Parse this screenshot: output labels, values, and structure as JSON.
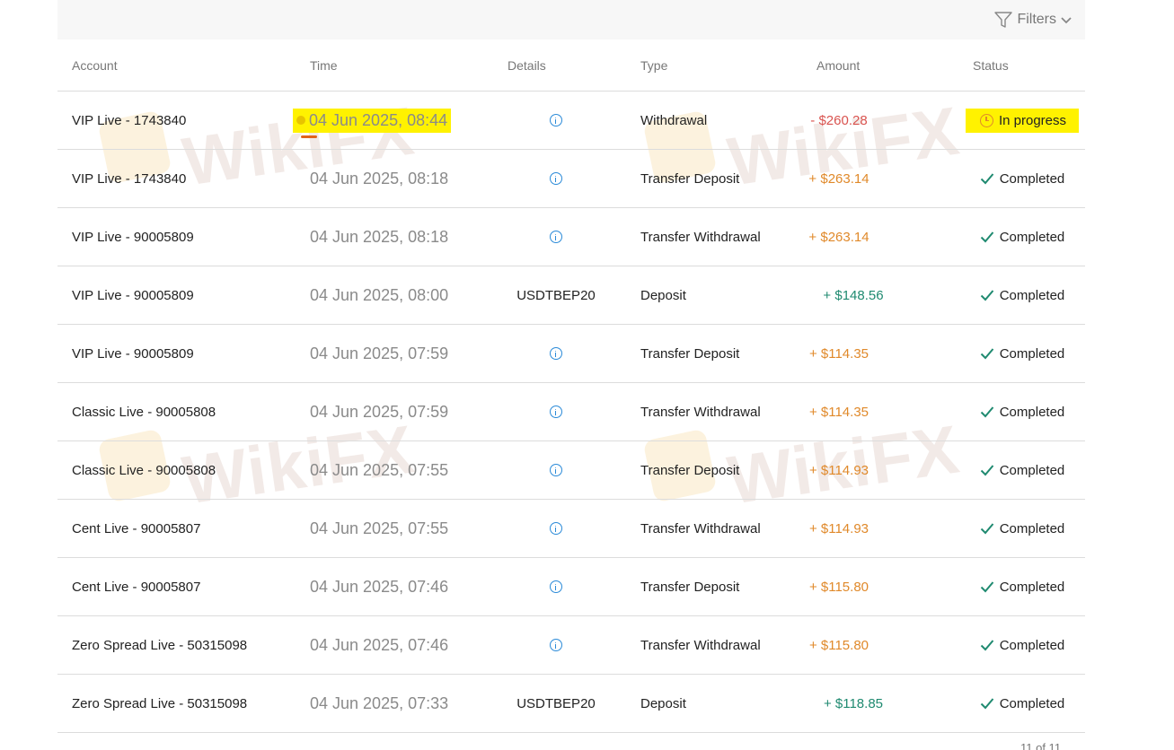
{
  "filters": {
    "label": "Filters"
  },
  "columns": {
    "account": "Account",
    "time": "Time",
    "details": "Details",
    "type": "Type",
    "amount": "Amount",
    "status": "Status"
  },
  "rows": [
    {
      "account": "VIP Live - 1743840",
      "time": "04 Jun 2025, 08:44",
      "details": "",
      "type": "Withdrawal",
      "amount": "- $260.28",
      "status": "In progress"
    },
    {
      "account": "VIP Live - 1743840",
      "time": "04 Jun 2025, 08:18",
      "details": "",
      "type": "Transfer Deposit",
      "amount": "+ $263.14",
      "status": "Completed"
    },
    {
      "account": "VIP Live - 90005809",
      "time": "04 Jun 2025, 08:18",
      "details": "",
      "type": "Transfer Withdrawal",
      "amount": "+ $263.14",
      "status": "Completed"
    },
    {
      "account": "VIP Live - 90005809",
      "time": "04 Jun 2025, 08:00",
      "details": "USDTBEP20",
      "type": "Deposit",
      "amount": "+ $148.56",
      "status": "Completed"
    },
    {
      "account": "VIP Live - 90005809",
      "time": "04 Jun 2025, 07:59",
      "details": "",
      "type": "Transfer Deposit",
      "amount": "+ $114.35",
      "status": "Completed"
    },
    {
      "account": "Classic Live - 90005808",
      "time": "04 Jun 2025, 07:59",
      "details": "",
      "type": "Transfer Withdrawal",
      "amount": "+ $114.35",
      "status": "Completed"
    },
    {
      "account": "Classic Live - 90005808",
      "time": "04 Jun 2025, 07:55",
      "details": "",
      "type": "Transfer Deposit",
      "amount": "+ $114.93",
      "status": "Completed"
    },
    {
      "account": "Cent Live - 90005807",
      "time": "04 Jun 2025, 07:55",
      "details": "",
      "type": "Transfer Withdrawal",
      "amount": "+ $114.93",
      "status": "Completed"
    },
    {
      "account": "Cent Live - 90005807",
      "time": "04 Jun 2025, 07:46",
      "details": "",
      "type": "Transfer Deposit",
      "amount": "+ $115.80",
      "status": "Completed"
    },
    {
      "account": "Zero Spread Live - 50315098",
      "time": "04 Jun 2025, 07:46",
      "details": "",
      "type": "Transfer Withdrawal",
      "amount": "+ $115.80",
      "status": "Completed"
    },
    {
      "account": "Zero Spread Live - 50315098",
      "time": "04 Jun 2025, 07:33",
      "details": "USDTBEP20",
      "type": "Deposit",
      "amount": "+ $118.85",
      "status": "Completed"
    }
  ],
  "watermark": {
    "text": "WikiFX"
  },
  "pagination": {
    "label": "11 of 11"
  },
  "colors": {
    "highlight": "#fff200",
    "amount_negative": "#d9534f",
    "amount_transfer": "#e0892a",
    "amount_positive": "#1f8a70",
    "status_check": "#1f8a70",
    "info_icon": "#2a8ad8"
  }
}
